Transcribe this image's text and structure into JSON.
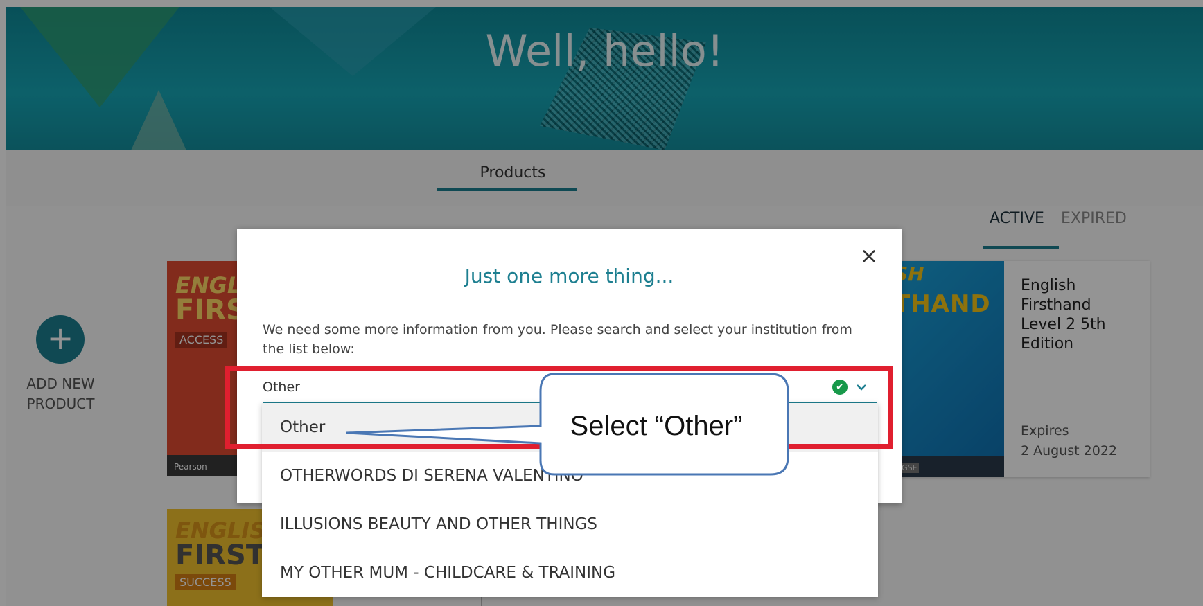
{
  "hero": {
    "title": "Well, hello!"
  },
  "tabs": [
    {
      "label": "Products"
    }
  ],
  "add_product": {
    "icon": "+",
    "label_line1": "ADD NEW",
    "label_line2": "PRODUCT"
  },
  "filters": {
    "active": "ACTIVE",
    "expired": "EXPIRED"
  },
  "products": [
    {
      "cover_line1": "ENGLIS",
      "cover_line2": "FIRS",
      "cover_badge": "ACCESS",
      "publisher": "Pearson"
    },
    {
      "cover_line1": "SH",
      "cover_line2": "THAND",
      "cover_badge": "GSE",
      "title_lines": [
        "English",
        "Firsthand",
        "Level 2 5th",
        "Edition"
      ],
      "expires_label": "Expires",
      "expires_date": "2 August 2022"
    },
    {
      "cover_line1": "ENGLISH",
      "cover_line2": "FIRSTH",
      "cover_badge": "SUCCESS"
    }
  ],
  "modal": {
    "close_icon": "×",
    "title": "Just one more thing...",
    "description": "We need some more information from you. Please search and select your institution from the list below:",
    "input_value": "Other",
    "valid_icon": "✔"
  },
  "dropdown": {
    "options": [
      "Other",
      "OTHERWORDS DI SERENA VALENTINO",
      "ILLUSIONS BEAUTY AND OTHER THINGS",
      "MY OTHER MUM - CHILDCARE & TRAINING"
    ],
    "selected_index": 0
  },
  "annotation": {
    "callout": "Select “Other”",
    "box_color": "#e01f2f",
    "callout_border": "#4a77b4"
  },
  "colors": {
    "accent": "#1d7f90",
    "success": "#17994a"
  }
}
